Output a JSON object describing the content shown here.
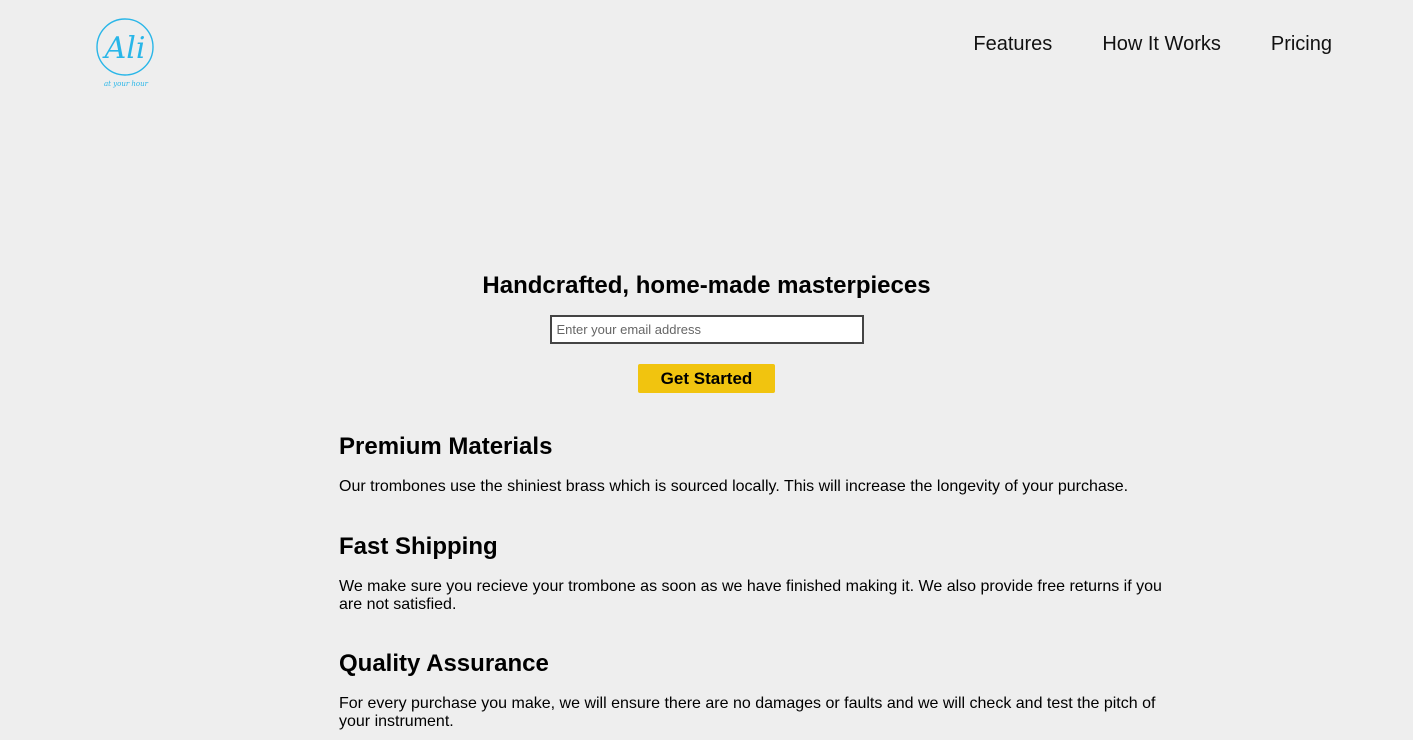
{
  "logo": {
    "name": "Ali",
    "tagline": "at your hour",
    "color": "#29b6e8"
  },
  "nav": {
    "items": [
      {
        "label": "Features"
      },
      {
        "label": "How It Works"
      },
      {
        "label": "Pricing"
      }
    ]
  },
  "hero": {
    "title": "Handcrafted, home-made masterpieces",
    "email_placeholder": "Enter your email address",
    "email_value": "",
    "cta_label": "Get Started",
    "cta_color": "#f1c40f"
  },
  "features": [
    {
      "title": "Premium Materials",
      "text": "Our trombones use the shiniest brass which is sourced locally. This will increase the longevity of your purchase."
    },
    {
      "title": "Fast Shipping",
      "text": "We make sure you recieve your trombone as soon as we have finished making it. We also provide free returns if you are not satisfied."
    },
    {
      "title": "Quality Assurance",
      "text": "For every purchase you make, we will ensure there are no damages or faults and we will check and test the pitch of your instrument."
    }
  ],
  "colors": {
    "background": "#eeeeee",
    "text": "#000000"
  }
}
